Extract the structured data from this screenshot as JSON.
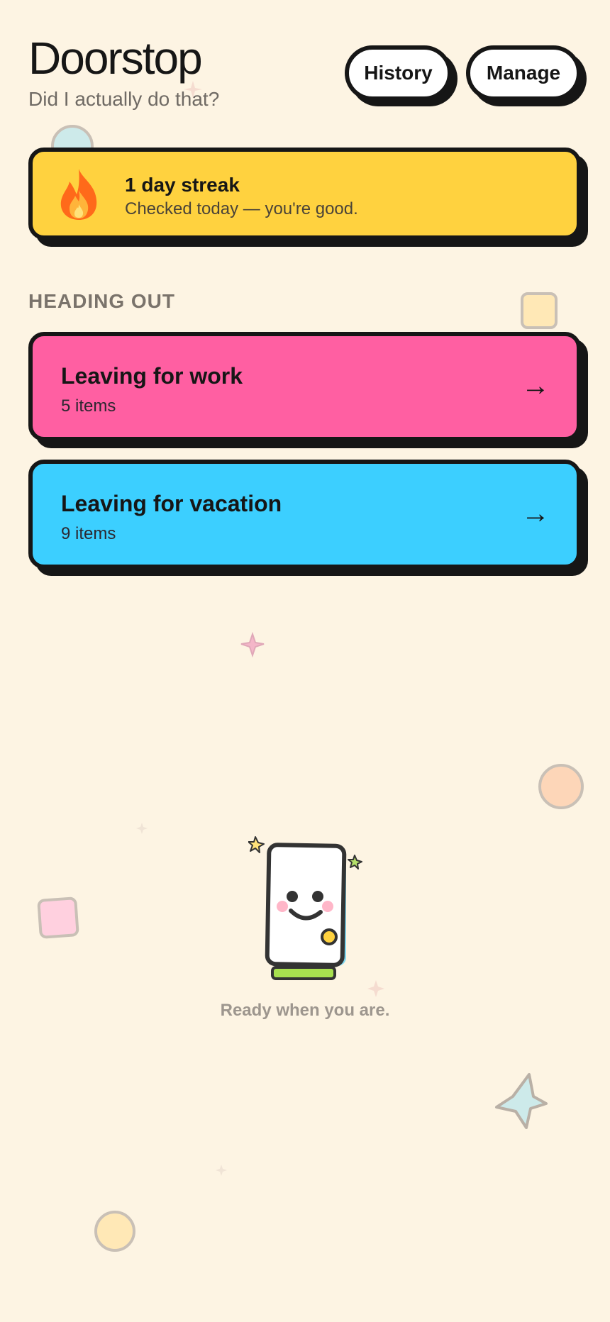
{
  "header": {
    "title": "Doorstop",
    "subtitle": "Did I actually do that?",
    "history_label": "History",
    "manage_label": "Manage"
  },
  "streak": {
    "icon": "fire-icon",
    "title": "1 day streak",
    "subtitle": "Checked today — you're good.",
    "color": "#ffd23f"
  },
  "section": {
    "heading": "HEADING OUT"
  },
  "lists": [
    {
      "title": "Leaving for work",
      "count": "5 items",
      "arrow": "→",
      "color": "#ff5fa2"
    },
    {
      "title": "Leaving for vacation",
      "count": "9 items",
      "arrow": "→",
      "color": "#3ccfff"
    }
  ],
  "empty_state": {
    "illustration": "smiling-door-illustration",
    "message": "Ready when you are."
  },
  "colors": {
    "background": "#fdf4e3",
    "ink": "#161616"
  }
}
